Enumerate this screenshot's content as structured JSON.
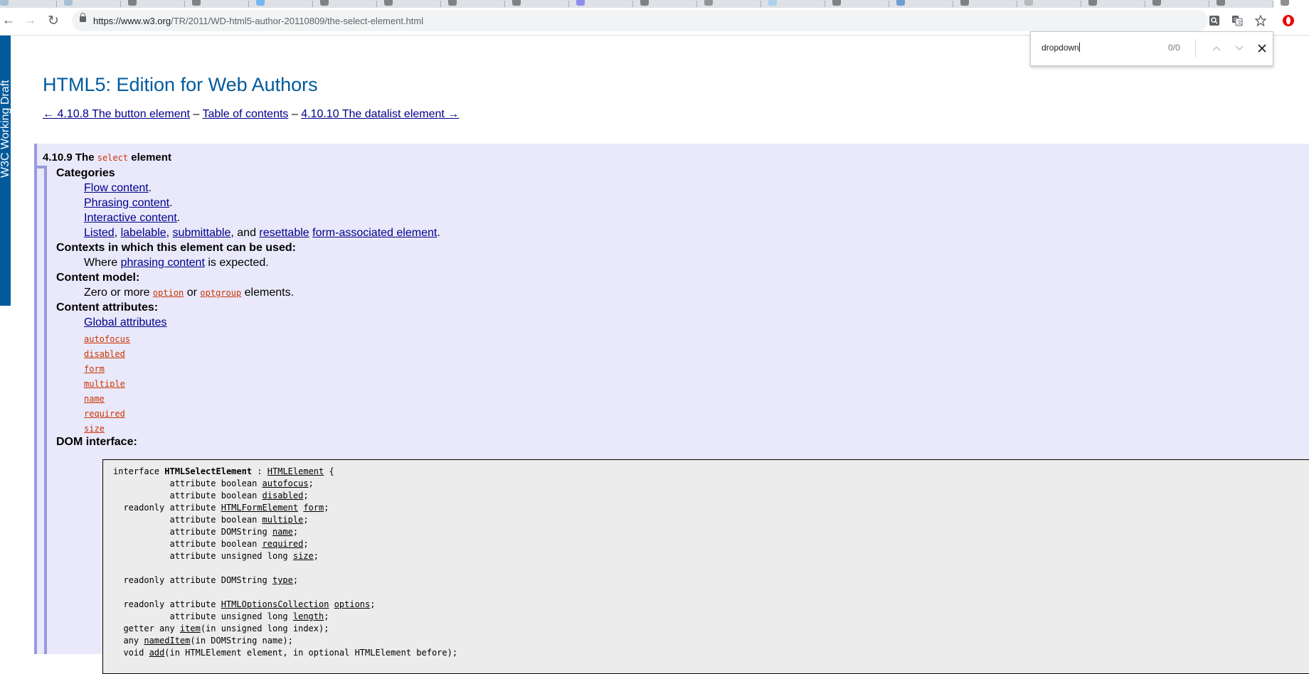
{
  "browser": {
    "tab_count": 21,
    "url_host": "https://www.w3.org",
    "url_path": "/TR/2011/WD-html5-author-20110809/the-select-element.html",
    "nav": {
      "back_glyph": "←",
      "forward_glyph": "→",
      "reload_glyph": "↻"
    },
    "icons": [
      "lock-icon",
      "zoom-icon",
      "translate-icon",
      "bookmark-star-icon",
      "opera-extension-icon"
    ]
  },
  "find_bar": {
    "query": "dropdown",
    "count": "0/0"
  },
  "banner": {
    "text": "W3C Working Draft"
  },
  "page": {
    "title": "HTML5: Edition for Web Authors",
    "prev_link": "← 4.10.8 The button element",
    "sep1": " – ",
    "toc_link": "Table of contents",
    "sep2": " – ",
    "next_link": "4.10.10 The datalist element →"
  },
  "section": {
    "heading_num": "4.10.9 The ",
    "heading_code": "select",
    "heading_end": " element",
    "categories_label": "Categories",
    "categories": {
      "flow": "Flow content",
      "phrasing": "Phrasing content",
      "interactive": "Interactive content",
      "listed": "Listed",
      "labelable": "labelable",
      "submittable": "submittable",
      "and": ", and ",
      "resettable": "resettable",
      "form_assoc": "form-associated element",
      "period": "."
    },
    "contexts_label": "Contexts in which this element can be used:",
    "contexts": {
      "pre": "Where ",
      "link": "phrasing content",
      "post": " is expected."
    },
    "model_label": "Content model:",
    "model": {
      "pre": "Zero or more ",
      "option": "option",
      "or": " or ",
      "optgroup": "optgroup",
      "post": " elements."
    },
    "attrs_label": "Content attributes:",
    "global_attrs": "Global attributes",
    "attrs": [
      "autofocus",
      "disabled",
      "form",
      "multiple",
      "name",
      "required",
      "size"
    ],
    "dom_label": "DOM interface:"
  },
  "idl": {
    "l1_pre": "interface ",
    "l1_name": "HTMLSelectElement",
    "l1_mid": " : ",
    "l1_parent": "HTMLElement",
    "l1_post": " {",
    "lines": [
      {
        "pre": "           attribute boolean ",
        "link": "autofocus",
        "post": ";"
      },
      {
        "pre": "           attribute boolean ",
        "link": "disabled",
        "post": ";"
      },
      {
        "pre": "  readonly attribute ",
        "link": "HTMLFormElement",
        "mid": " ",
        "link2": "form",
        "post": ";"
      },
      {
        "pre": "           attribute boolean ",
        "link": "multiple",
        "post": ";"
      },
      {
        "pre": "           attribute DOMString ",
        "link": "name",
        "post": ";"
      },
      {
        "pre": "           attribute boolean ",
        "link": "required",
        "post": ";"
      },
      {
        "pre": "           attribute unsigned long ",
        "link": "size",
        "post": ";"
      },
      {
        "pre": "",
        "link": "",
        "post": ""
      },
      {
        "pre": "  readonly attribute DOMString ",
        "link": "type",
        "post": ";"
      },
      {
        "pre": "",
        "link": "",
        "post": ""
      },
      {
        "pre": "  readonly attribute ",
        "link": "HTMLOptionsCollection",
        "mid": " ",
        "link2": "options",
        "post": ";"
      },
      {
        "pre": "           attribute unsigned long ",
        "link": "length",
        "post": ";"
      },
      {
        "pre": "  getter any ",
        "link": "item",
        "post": "(in unsigned long index);"
      },
      {
        "pre": "  any ",
        "link": "namedItem",
        "post": "(in DOMString name);"
      },
      {
        "pre": "  void ",
        "link": "add",
        "post": "(in HTMLElement element, in optional HTMLElement before);"
      }
    ]
  }
}
